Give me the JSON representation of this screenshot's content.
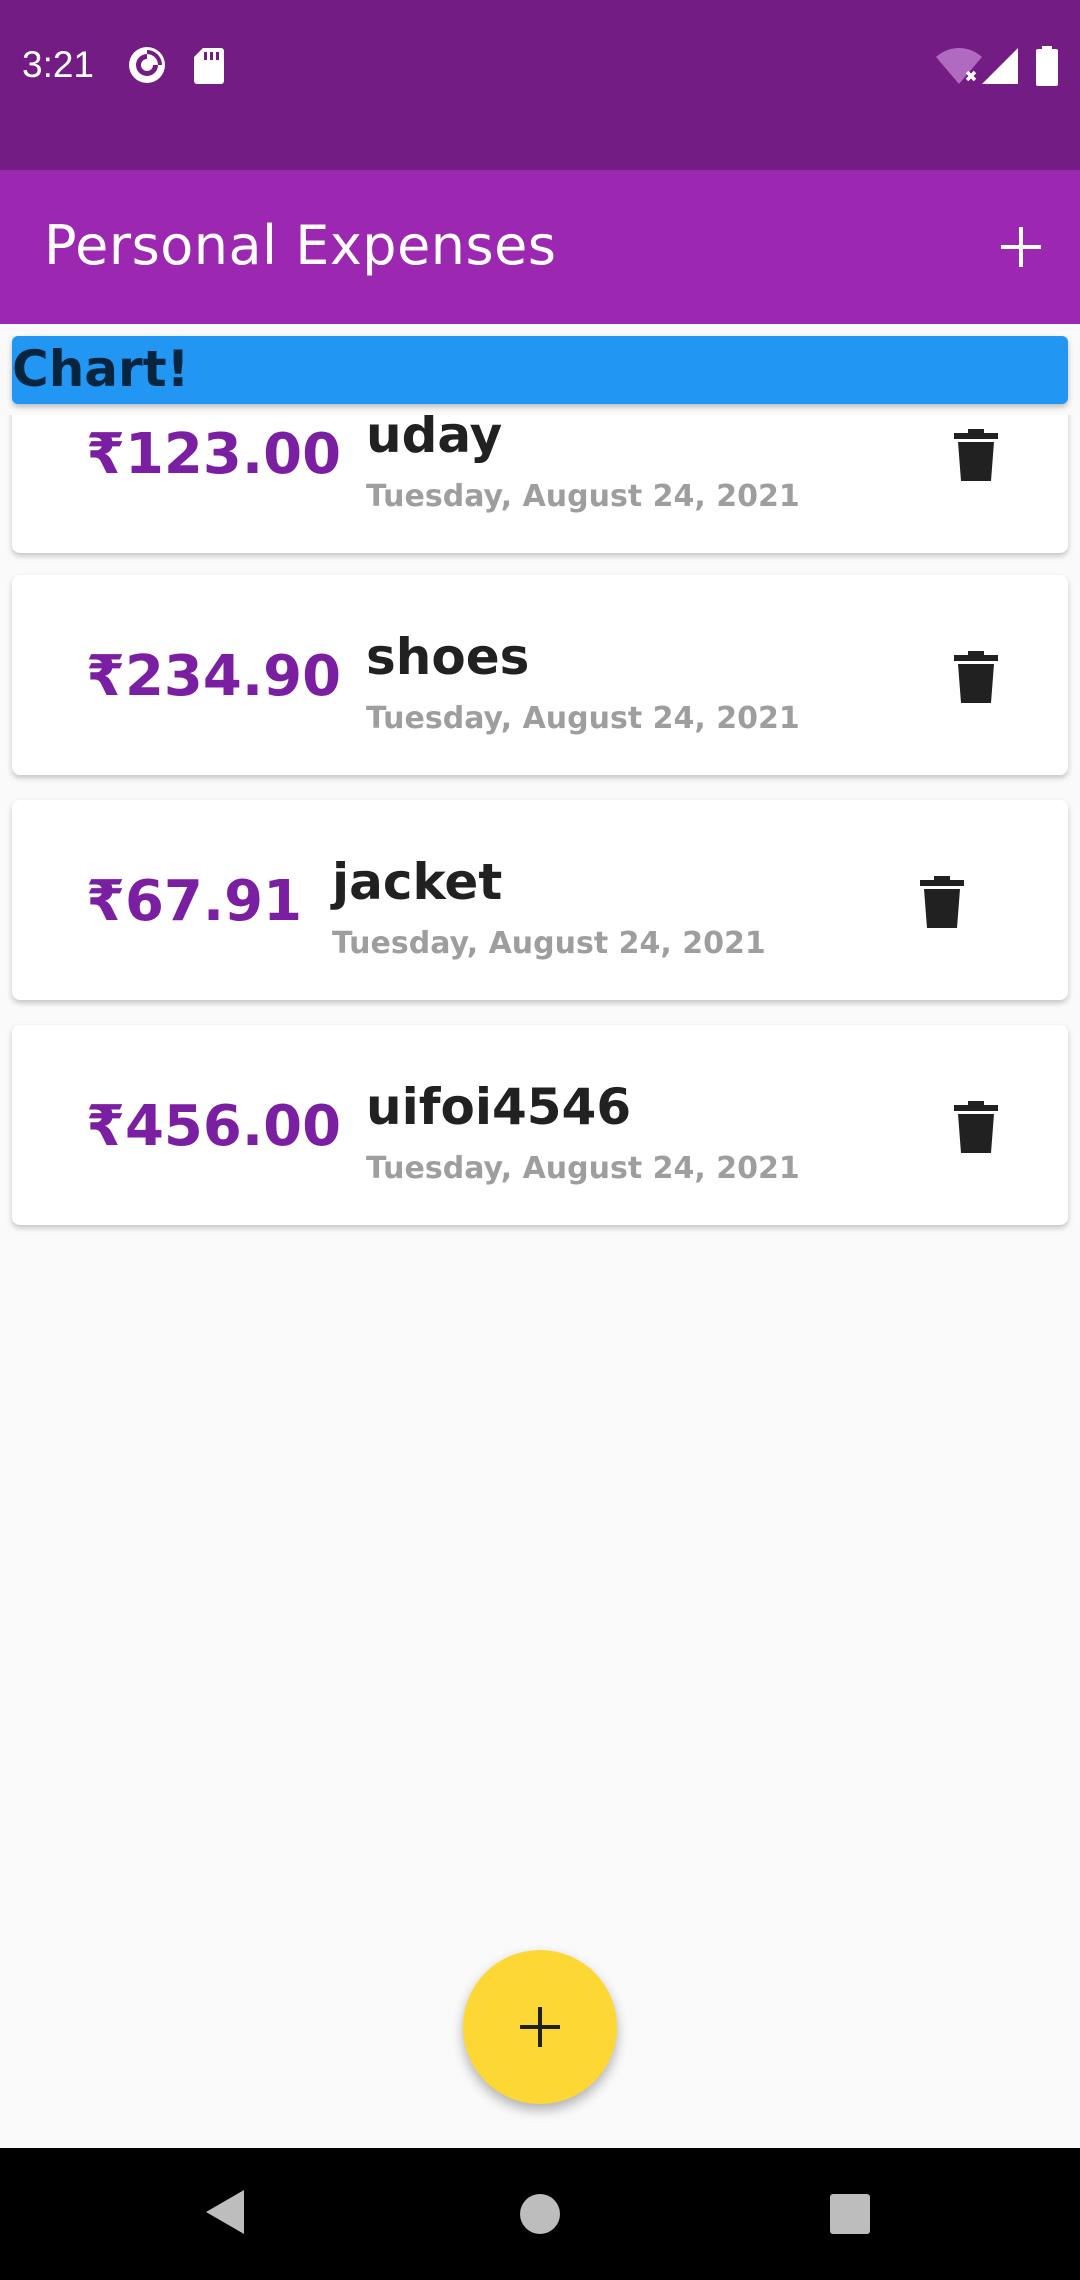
{
  "status_bar": {
    "time": "3:21",
    "icons": [
      "pocket-casts-icon",
      "sd-card-icon",
      "wifi-off-icon",
      "cell-signal-icon",
      "battery-icon"
    ]
  },
  "app_bar": {
    "title": "Personal Expenses",
    "add_icon": "plus-icon"
  },
  "chart": {
    "label": "Chart!",
    "color": "#2196f3"
  },
  "transactions": [
    {
      "amount": "₹123.00",
      "title": "uday",
      "date": "Tuesday, August 24, 2021"
    },
    {
      "amount": "₹234.90",
      "title": "shoes",
      "date": "Tuesday, August 24, 2021"
    },
    {
      "amount": "₹67.91",
      "title": "jacket",
      "date": "Tuesday, August 24, 2021"
    },
    {
      "amount": "₹456.00",
      "title": "uifoi4546",
      "date": "Tuesday, August 24, 2021"
    }
  ],
  "fab": {
    "icon": "plus-icon",
    "color": "#fdd835"
  },
  "nav_bar": {
    "icons": [
      "back-icon",
      "home-icon",
      "recents-icon"
    ]
  },
  "colors": {
    "status_bar": "#721c84",
    "app_bar": "#9c27b0",
    "amount": "#7b1fa2",
    "background": "#fafafa"
  }
}
